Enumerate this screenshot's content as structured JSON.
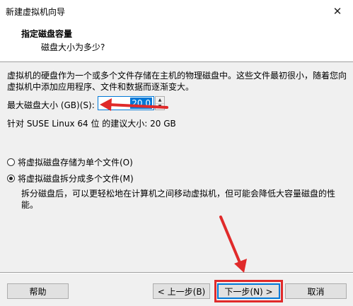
{
  "window": {
    "title": "新建虚拟机向导",
    "close_icon": "close-icon"
  },
  "header": {
    "title": "指定磁盘容量",
    "subtitle": "磁盘大小为多少?"
  },
  "description": "虚拟机的硬盘作为一个或多个文件存储在主机的物理磁盘中。这些文件最初很小，随着您向虚拟机中添加应用程序、文件和数据而逐渐变大。",
  "disk_size": {
    "label": "最大磁盘大小 (GB)(S):",
    "value": "20.0"
  },
  "recommendation": "针对 SUSE Linux 64 位 的建议大小: 20 GB",
  "options": {
    "single": {
      "label": "将虚拟磁盘存储为单个文件(O)",
      "checked": false
    },
    "split": {
      "label": "将虚拟磁盘拆分成多个文件(M)",
      "checked": true
    },
    "split_description": "拆分磁盘后，可以更轻松地在计算机之间移动虚拟机，但可能会降低大容量磁盘的性能。"
  },
  "buttons": {
    "help": "帮助",
    "back": "< 上一步(B)",
    "next": "下一步(N) >",
    "cancel": "取消"
  },
  "annotation_color": "#e02a2a",
  "accent_color": "#0078d7"
}
